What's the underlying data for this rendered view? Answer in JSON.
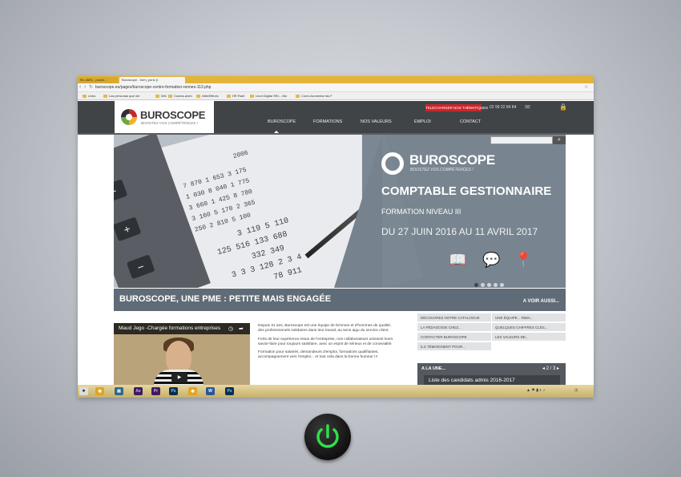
{
  "browser": {
    "tabs": [
      {
        "label": "fbs (885) - parole..."
      },
      {
        "label": "Buroscope - form_pons (i"
      }
    ],
    "url": "buroscope.eu/pages/buroscope-centre-formation-rennes-113.php",
    "bookmarks": [
      "Links",
      "Las personas que mir",
      "Wix",
      "Coutos-anim",
      "AfterEffects",
      "HR Raet",
      "Linot Digital SRL - Ma",
      "Como Aumentar las F"
    ]
  },
  "header": {
    "logo_text": "BUROSCOPE",
    "logo_tagline": "BOOSTEZ VOS COMPÉTENCES !",
    "cta_label": "TELECHARGER NOS THÉMATIQUES",
    "phone": "02 99 22 84 84",
    "menu": [
      "BUROSCOPE",
      "FORMATIONS",
      "NOS VALEURS",
      "EMPLOI",
      "CONTACT"
    ]
  },
  "hero": {
    "paper_rows": [
      "2006",
      "7 870  1 653  3 175",
      "1 030  8 040  1 775",
      "3 660  1 425  8 780",
      "3 160  5 170  2 365",
      "250  2 810  5 100",
      "3 119  5 110",
      "125 516  133 688",
      "332  349",
      "3 3 3  128  2 3 4",
      "78 911"
    ],
    "calc_keys": [
      "−",
      "+",
      "−"
    ],
    "logo_text": "BUROSCOPE",
    "logo_tagline": "BOOSTEZ VOS COMPÉTENCES !",
    "title": "COMPTABLE GESTIONNAIRE",
    "subtitle": "FORMATION NIVEAU III",
    "dates": "DU 27 JUIN 2016 AU 11 AVRIL 2017",
    "icons": [
      "book-icon",
      "chat-icon",
      "location-pin-icon"
    ],
    "slide_count": 5,
    "active_slide": 1
  },
  "banner": {
    "title": "BUROSCOPE, UNE PME : PETITE MAIS ENGAGÉE",
    "more_label": "A VOIR AUSSI..."
  },
  "video": {
    "title": "Maud Jego -Chargée formations entreprises"
  },
  "body_text": {
    "p1": "Depuis 31 ans, Buroscope est une équipe de femmes et d'hommes de qualité, des professionnels solidaires dans leur travail, au sens aigu du service client.",
    "p2": "Forts de leur expérience issue de l'entreprise, nos collaborateurs unissent leurs savoir-faire pour toujours satisfaire, avec un esprit de sérieux et de convivialité.",
    "p3": "Formation pour salariés, demandeurs d'emploi, formations qualifiantes, accompagnement vers l'emploi... et tout cela dans la bonne humeur !!!"
  },
  "links": [
    "DÉCOUVREZ NOTRE CATALOGUE",
    "UNE ÉQUIPE... RIEN...",
    "LA PÉDAGOGIE CHEZ...",
    "QUELQUES CHIFFRES CLÉS...",
    "CONTACTER BUROSCOPE",
    "LES VALEURS DE...",
    "ILS TÉMOIGNENT POUR..."
  ],
  "alaune": {
    "title": "A LA UNE...",
    "pager": "2 / 3",
    "item": "Liste des candidats admis 2016-2017"
  },
  "taskbar": {
    "apps": [
      "Ae",
      "Pr",
      "Ps",
      "Ps"
    ],
    "colors": {
      "ae": "#3a1c5c",
      "pr": "#3a1c5c",
      "ps": "#0d2d4e"
    }
  },
  "colors": {
    "header_bg": "#414447",
    "hero_panel": "#76828e",
    "cta_red": "#c9262b",
    "power_green": "#2fe04a"
  }
}
